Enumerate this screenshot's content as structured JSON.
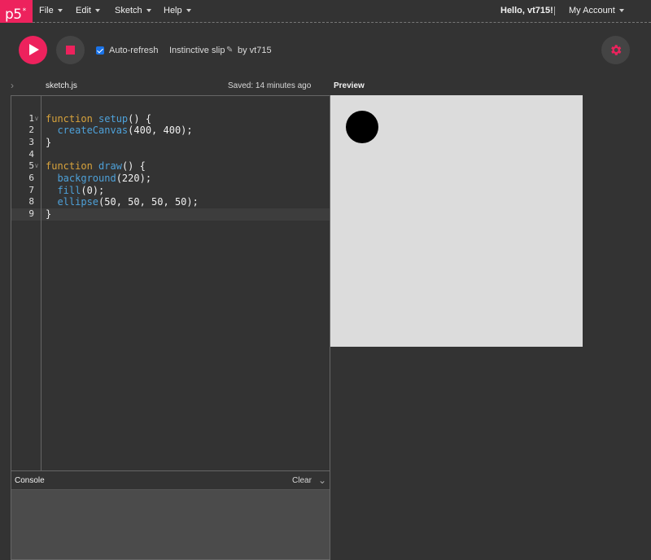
{
  "nav": {
    "logo": "p5",
    "logo_mark": "*",
    "menus": [
      "File",
      "Edit",
      "Sketch",
      "Help"
    ],
    "greeting": "Hello, vt715!",
    "account": "My Account"
  },
  "toolbar": {
    "auto_refresh_label": "Auto-refresh",
    "auto_refresh_checked": true,
    "sketch_name": "Instinctive slip",
    "author": "by vt715",
    "icons": [
      "play-icon",
      "stop-icon",
      "pencil-icon",
      "gear-icon"
    ],
    "accent_color": "#ed225d"
  },
  "editor": {
    "file_name": "sketch.js",
    "saved_status": "Saved: 14 minutes ago",
    "line_numbers": [
      "1",
      "2",
      "3",
      "4",
      "5",
      "6",
      "7",
      "8",
      "9"
    ],
    "code": [
      [
        [
          "kw",
          "function "
        ],
        [
          "fn",
          "setup"
        ],
        [
          "pl",
          "() {"
        ]
      ],
      [
        [
          "pl",
          "  "
        ],
        [
          "fn",
          "createCanvas"
        ],
        [
          "pl",
          "(400, 400);"
        ]
      ],
      [
        [
          "pl",
          "}"
        ]
      ],
      [],
      [
        [
          "kw",
          "function "
        ],
        [
          "fn",
          "draw"
        ],
        [
          "pl",
          "() {"
        ]
      ],
      [
        [
          "pl",
          "  "
        ],
        [
          "fn",
          "background"
        ],
        [
          "pl",
          "(220);"
        ]
      ],
      [
        [
          "pl",
          "  "
        ],
        [
          "fn",
          "fill"
        ],
        [
          "pl",
          "(0);"
        ]
      ],
      [
        [
          "pl",
          "  "
        ],
        [
          "fn",
          "ellipse"
        ],
        [
          "pl",
          "(50, 50, 50, 50);"
        ]
      ],
      [
        [
          "pl",
          "}"
        ]
      ]
    ],
    "active_line": 9
  },
  "console": {
    "title": "Console",
    "clear_label": "Clear"
  },
  "preview": {
    "title": "Preview",
    "canvas_background": "#dcdcdc",
    "ellipse_fill": "#000000"
  }
}
